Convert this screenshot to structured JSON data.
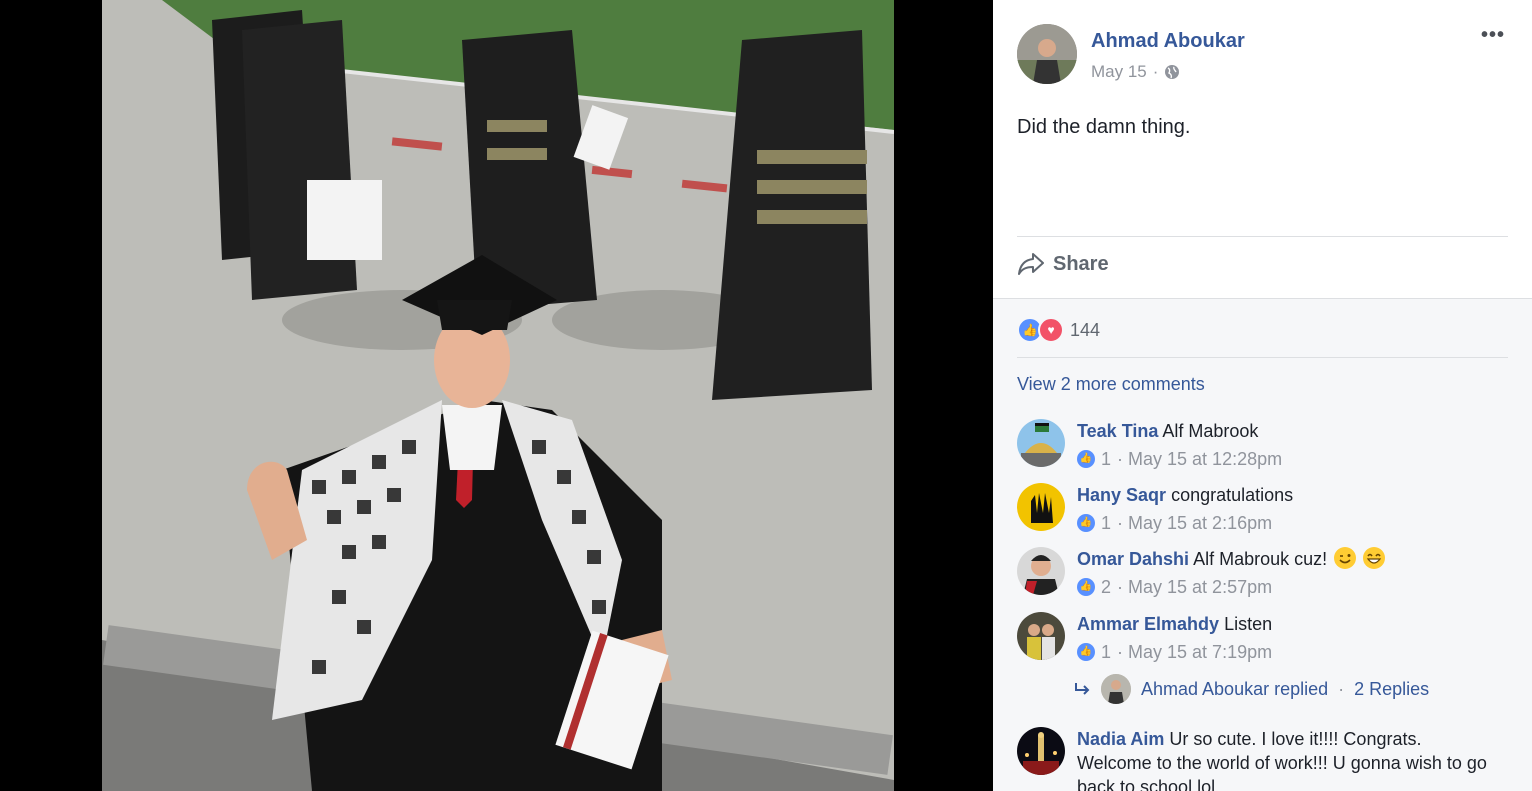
{
  "post": {
    "author": "Ahmad Aboukar",
    "date": "May 15",
    "separator": "·",
    "text": "Did the damn thing.",
    "more_label": "•••",
    "share_label": "Share",
    "privacy_icon": "globe-icon"
  },
  "reactions": {
    "count": "144",
    "types": [
      "like",
      "love"
    ]
  },
  "view_more_label": "View 2 more comments",
  "comments": [
    {
      "name": "Teak Tina",
      "text": "Alf Mabrook",
      "likes": "1",
      "time": "· May 15 at 12:28pm"
    },
    {
      "name": "Hany Saqr",
      "text": "congratulations",
      "likes": "1",
      "time": "· May 15 at 2:16pm"
    },
    {
      "name": "Omar Dahshi",
      "text": "Alf Mabrouk cuz!",
      "likes": "2",
      "time": "· May 15 at 2:57pm"
    },
    {
      "name": "Ammar Elmahdy",
      "text": "Listen",
      "likes": "1",
      "time": "· May 15 at 7:19pm"
    },
    {
      "name": "Nadia Aim",
      "text": "Ur so cute. I love it!!!! Congrats. Welcome to the world of work!!! U gonna wish to go back to school lol"
    }
  ],
  "reply_summary": {
    "author": "Ahmad Aboukar replied",
    "separator": "·",
    "count_label": "2 Replies"
  },
  "colors": {
    "link": "#365899",
    "meta": "#90949c",
    "like": "#5890ff",
    "love": "#f25268"
  }
}
